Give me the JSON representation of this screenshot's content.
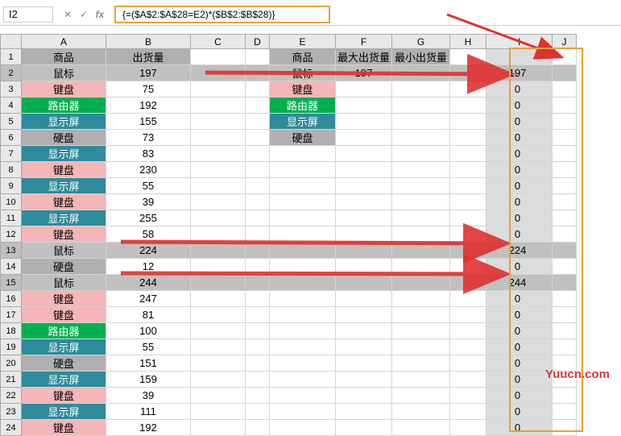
{
  "formula_bar": {
    "name_box": "I2",
    "cancel_sym": "✕",
    "enter_sym": "✓",
    "fx_label": "fx",
    "formula": "{=($A$2:$A$28=E2)*($B$2:$B$28)}"
  },
  "columns": [
    "",
    "A",
    "B",
    "C",
    "D",
    "E",
    "F",
    "G",
    "H",
    "I",
    "J"
  ],
  "headers": {
    "A1": "商品",
    "B1": "出货量",
    "E1": "商品",
    "F1": "最大出货量",
    "G1": "最小出货量"
  },
  "main_data": [
    {
      "row": 2,
      "name": "鼠标",
      "qty": 197,
      "class": "yellow"
    },
    {
      "row": 3,
      "name": "键盘",
      "qty": 75,
      "class": "pink"
    },
    {
      "row": 4,
      "name": "路由器",
      "qty": 192,
      "class": "green"
    },
    {
      "row": 5,
      "name": "显示屏",
      "qty": 155,
      "class": "teal"
    },
    {
      "row": 6,
      "name": "硬盘",
      "qty": 73,
      "class": "gray"
    },
    {
      "row": 7,
      "name": "显示屏",
      "qty": 83,
      "class": "teal"
    },
    {
      "row": 8,
      "name": "键盘",
      "qty": 230,
      "class": "pink"
    },
    {
      "row": 9,
      "name": "显示屏",
      "qty": 55,
      "class": "teal"
    },
    {
      "row": 10,
      "name": "键盘",
      "qty": 39,
      "class": "pink"
    },
    {
      "row": 11,
      "name": "显示屏",
      "qty": 255,
      "class": "teal"
    },
    {
      "row": 12,
      "name": "键盘",
      "qty": 58,
      "class": "pink"
    },
    {
      "row": 13,
      "name": "鼠标",
      "qty": 224,
      "class": "yellow"
    },
    {
      "row": 14,
      "name": "硬盘",
      "qty": 12,
      "class": "gray"
    },
    {
      "row": 15,
      "name": "鼠标",
      "qty": 244,
      "class": "yellow"
    },
    {
      "row": 16,
      "name": "键盘",
      "qty": 247,
      "class": "pink"
    },
    {
      "row": 17,
      "name": "键盘",
      "qty": 81,
      "class": "pink"
    },
    {
      "row": 18,
      "name": "路由器",
      "qty": 100,
      "class": "green"
    },
    {
      "row": 19,
      "name": "显示屏",
      "qty": 55,
      "class": "teal"
    },
    {
      "row": 20,
      "name": "硬盘",
      "qty": 151,
      "class": "gray"
    },
    {
      "row": 21,
      "name": "显示屏",
      "qty": 159,
      "class": "teal"
    },
    {
      "row": 22,
      "name": "键盘",
      "qty": 39,
      "class": "pink"
    },
    {
      "row": 23,
      "name": "显示屏",
      "qty": 111,
      "class": "teal"
    },
    {
      "row": 24,
      "name": "键盘",
      "qty": 192,
      "class": "pink"
    }
  ],
  "lookup_data": [
    {
      "row": 2,
      "name": "鼠标",
      "max": 197,
      "class": "yellow"
    },
    {
      "row": 3,
      "name": "键盘",
      "max": "",
      "class": "pink"
    },
    {
      "row": 4,
      "name": "路由器",
      "max": "",
      "class": "green"
    },
    {
      "row": 5,
      "name": "显示屏",
      "max": "",
      "class": "teal"
    },
    {
      "row": 6,
      "name": "硬盘",
      "max": "",
      "class": "gray"
    }
  ],
  "column_I": [
    197,
    0,
    0,
    0,
    0,
    0,
    0,
    0,
    0,
    0,
    0,
    224,
    0,
    244,
    0,
    0,
    0,
    0,
    0,
    0,
    0,
    0,
    0
  ],
  "highlight_rows": [
    2,
    13,
    15
  ],
  "watermark": "Yuucn.com"
}
